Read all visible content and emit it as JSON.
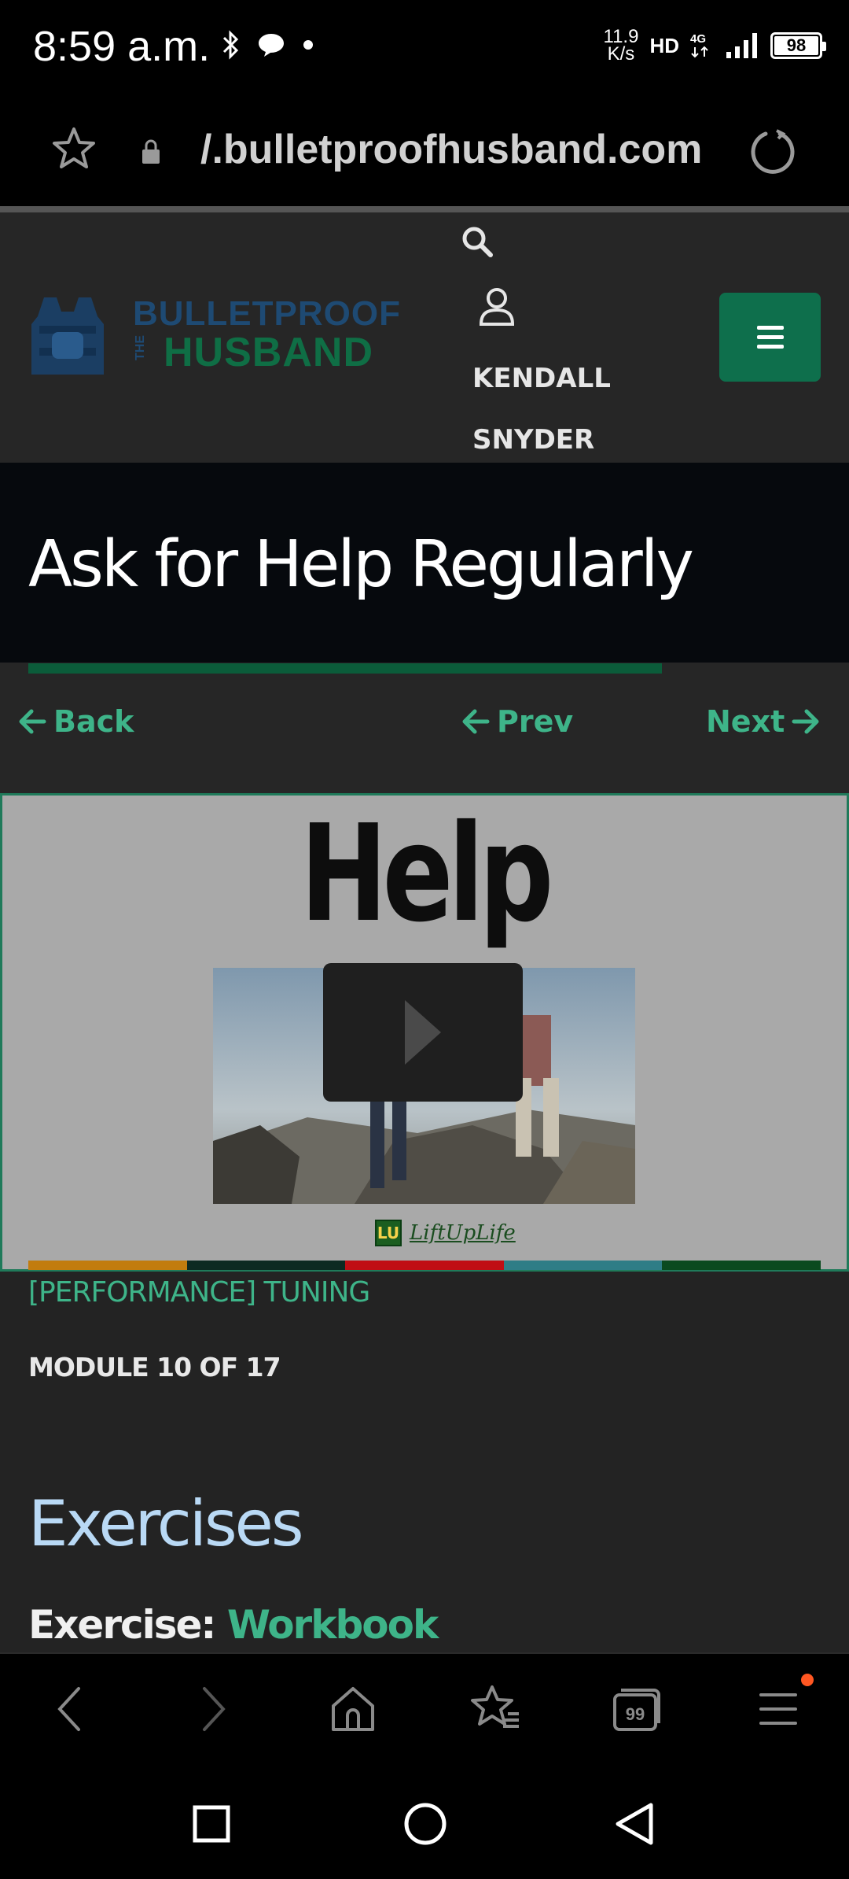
{
  "status_bar": {
    "time": "8:59 a.m.",
    "net_speed_value": "11.9",
    "net_speed_unit": "K/s",
    "hd_label": "HD",
    "network_type": "4G",
    "battery_level": "98"
  },
  "url_bar": {
    "url": "/.bulletproofhusband.com"
  },
  "header": {
    "logo_line1": "BULLETPROOF",
    "logo_the": "THE",
    "logo_line2": "HUSBAND",
    "user_name": "KENDALL SNYDER"
  },
  "lesson": {
    "title": "Ask for Help Regularly",
    "progress_fraction": 0.8
  },
  "nav": {
    "back_label": "Back",
    "prev_label": "Prev",
    "next_label": "Next"
  },
  "video": {
    "heading": "Help",
    "brand_icon_text": "LU",
    "brand_text": "LiftUpLife",
    "strip_colors": [
      "#c27c0e",
      "#0d2a22",
      "#c00e14",
      "#2f7d86",
      "#0b4a1f"
    ]
  },
  "content": {
    "course_name": "[PERFORMANCE] TUNING",
    "module_label": "MODULE 10 OF 17",
    "section_heading": "Exercises",
    "exercise_label": "Exercise: ",
    "exercise_link": "Workbook"
  },
  "colors": {
    "accent_green": "#3eb489",
    "menu_button": "#0e6f4c",
    "header_bg": "#262626",
    "title_bg": "#06090d"
  },
  "icons": {
    "toolbar": [
      "back-arrow-icon",
      "forward-arrow-icon",
      "home-icon",
      "bookmarks-icon",
      "tabs-icon",
      "menu-icon"
    ],
    "system": [
      "recents-square-icon",
      "home-circle-icon",
      "back-triangle-icon"
    ]
  }
}
